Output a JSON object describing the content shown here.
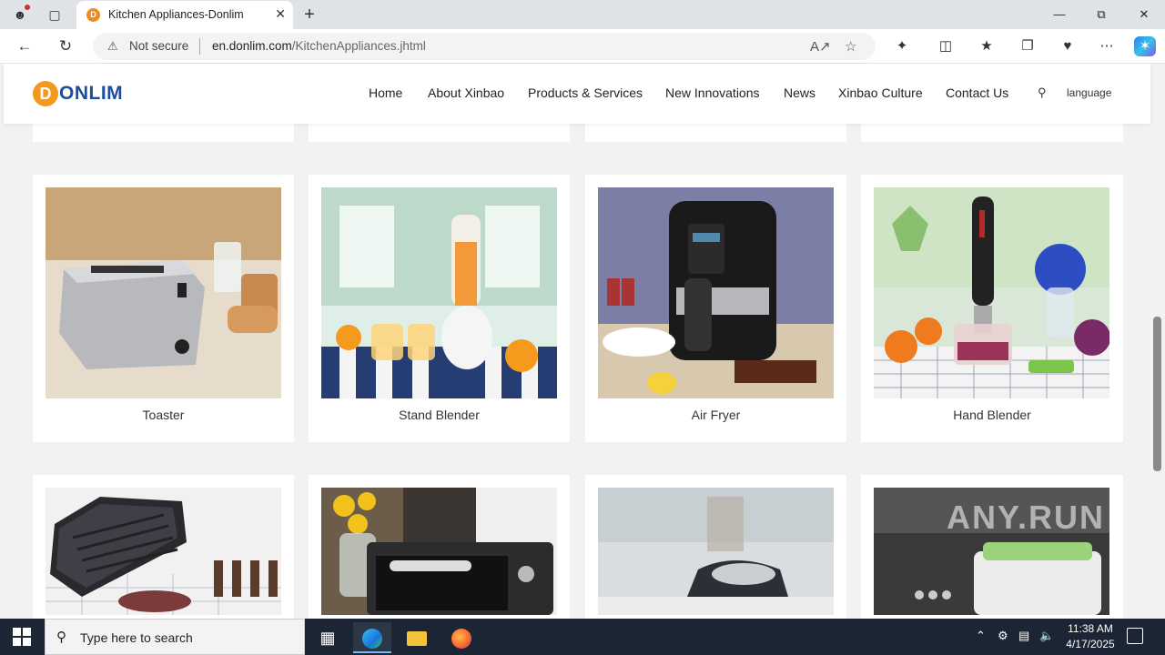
{
  "browser": {
    "tab_title": "Kitchen Appliances-Donlim",
    "tab_favicon": "D",
    "not_secure": "Not secure",
    "url_domain": "en.donlim.com",
    "url_path": "/KitchenAppliances.jhtml"
  },
  "site": {
    "logo_text": "ONLIM",
    "logo_mark": "D",
    "nav": [
      "Home",
      "About Xinbao",
      "Products & Services",
      "New Innovations",
      "News",
      "Xinbao Culture",
      "Contact Us"
    ],
    "language_label": "language",
    "accent_color": "#f39a1c",
    "brand_color": "#1b4da0"
  },
  "products": [
    {
      "name": "Toaster"
    },
    {
      "name": "Stand Blender"
    },
    {
      "name": "Air Fryer"
    },
    {
      "name": "Hand Blender"
    }
  ],
  "watermark": "ANY.RUN",
  "taskbar": {
    "search_placeholder": "Type here to search",
    "time": "11:38 AM",
    "date": "4/17/2025"
  }
}
